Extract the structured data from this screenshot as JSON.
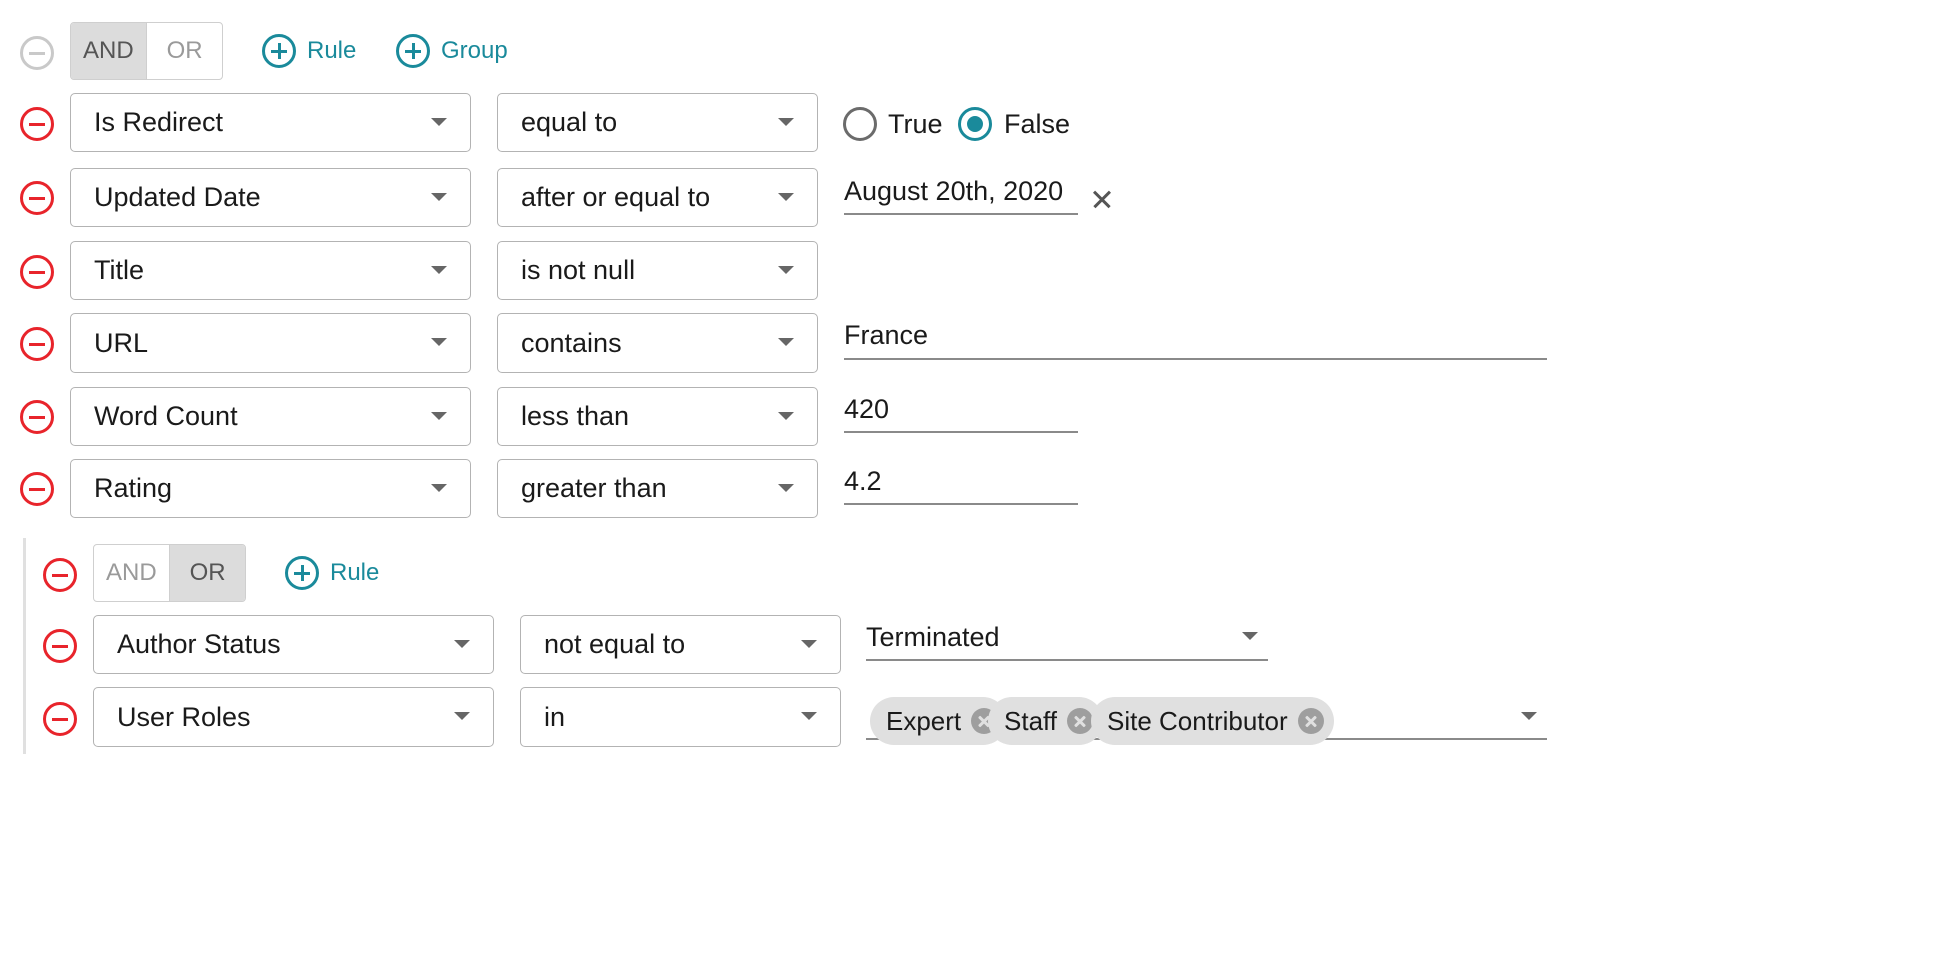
{
  "root_group": {
    "combinator_and": "AND",
    "combinator_or": "OR",
    "active": "AND",
    "add_rule_label": "Rule",
    "add_group_label": "Group"
  },
  "rules": [
    {
      "field": "Is Redirect",
      "operator": "equal to",
      "value_type": "radio",
      "options": [
        "True",
        "False"
      ],
      "selected": "False"
    },
    {
      "field": "Updated Date",
      "operator": "after or equal to",
      "value": "August 20th, 2020"
    },
    {
      "field": "Title",
      "operator": "is not null"
    },
    {
      "field": "URL",
      "operator": "contains",
      "value": "France"
    },
    {
      "field": "Word Count",
      "operator": "less than",
      "value": "420"
    },
    {
      "field": "Rating",
      "operator": "greater than",
      "value": "4.2"
    }
  ],
  "sub_group": {
    "combinator_and": "AND",
    "combinator_or": "OR",
    "active": "OR",
    "add_rule_label": "Rule",
    "rules": [
      {
        "field": "Author Status",
        "operator": "not equal to",
        "value": "Terminated"
      },
      {
        "field": "User Roles",
        "operator": "in",
        "chips": [
          "Expert",
          "Staff",
          "Site Contributor"
        ]
      }
    ]
  },
  "colors": {
    "accent": "#1a8a9b",
    "remove": "#e8242b",
    "toggle_active_bg": "#dcdcdc"
  },
  "icons": {
    "remove": "minus-circle-icon",
    "add": "plus-circle-icon",
    "dropdown": "caret-down-icon",
    "clear": "close-icon",
    "chip_delete": "cancel-circle-icon"
  }
}
